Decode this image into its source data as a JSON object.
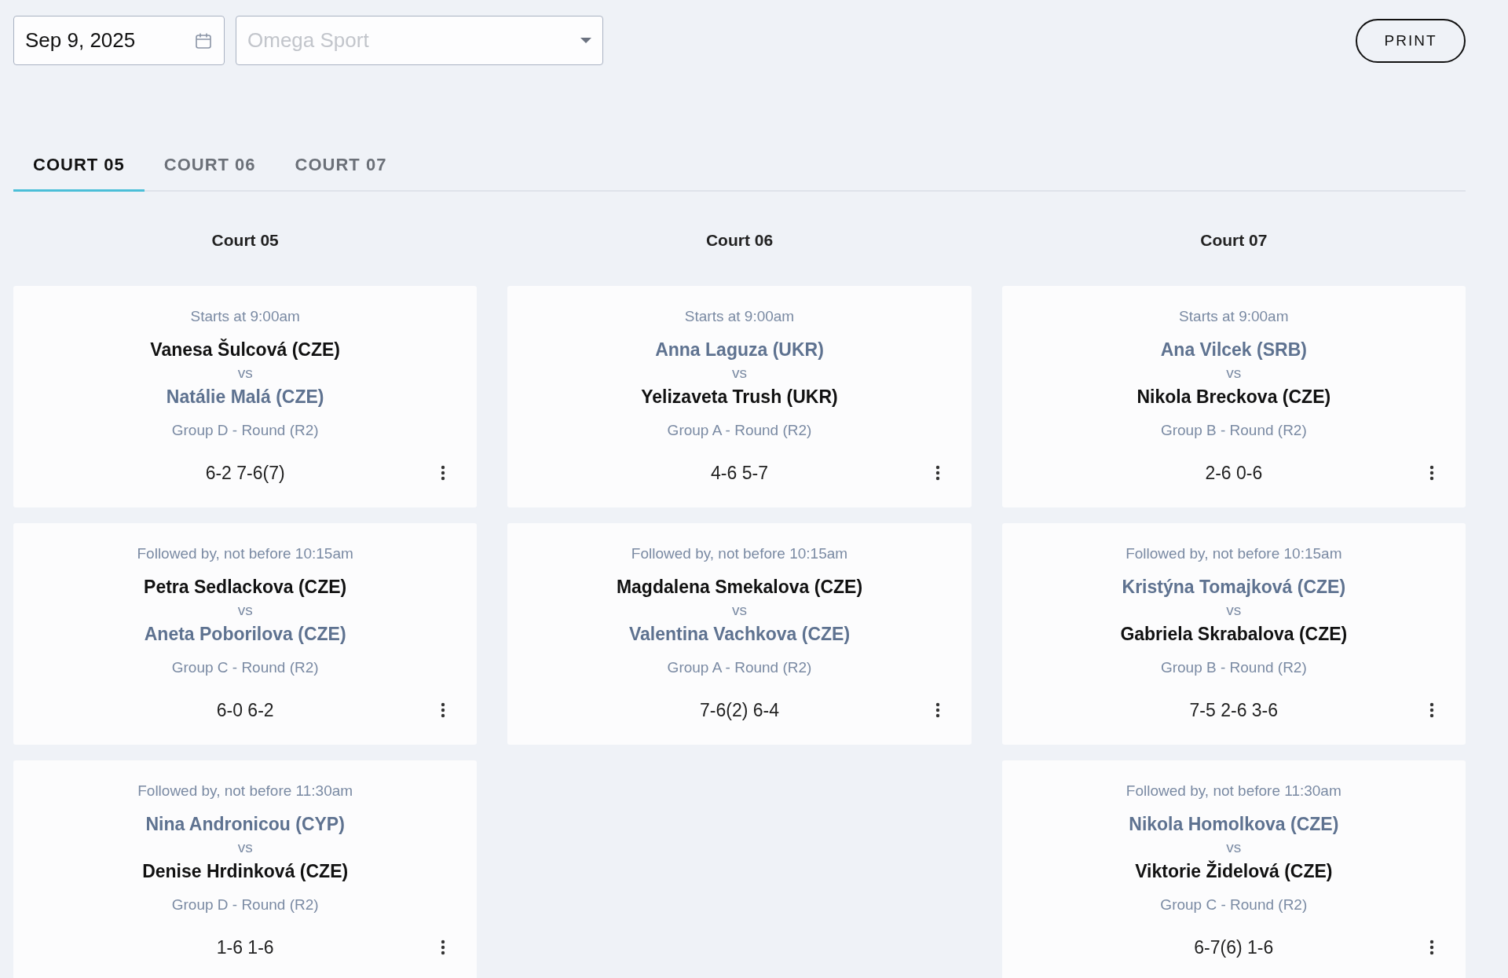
{
  "date_field": {
    "value": "Sep 9, 2025"
  },
  "venue_select": {
    "placeholder": "Omega Sport"
  },
  "print_button": "PRINT",
  "tabs": [
    {
      "label": "COURT 05",
      "selected": true
    },
    {
      "label": "COURT 06",
      "selected": false
    },
    {
      "label": "COURT 07",
      "selected": false
    }
  ],
  "courts": [
    {
      "title": "Court 05",
      "matches": [
        {
          "time": "Starts at 9:00am",
          "players": [
            {
              "name": "Vanesa Šulcová (CZE)",
              "winner": true
            },
            {
              "name": "Natálie Malá (CZE)",
              "winner": false
            }
          ],
          "vs": "vs",
          "round": "Group D - Round (R2)",
          "score": "6-2 7-6(7)"
        },
        {
          "time": "Followed by, not before 10:15am",
          "players": [
            {
              "name": "Petra Sedlackova (CZE)",
              "winner": true
            },
            {
              "name": "Aneta Poborilova (CZE)",
              "winner": false
            }
          ],
          "vs": "vs",
          "round": "Group C - Round (R2)",
          "score": "6-0 6-2"
        },
        {
          "time": "Followed by, not before 11:30am",
          "players": [
            {
              "name": "Nina Andronicou (CYP)",
              "winner": false
            },
            {
              "name": "Denise Hrdinková (CZE)",
              "winner": true
            }
          ],
          "vs": "vs",
          "round": "Group D - Round (R2)",
          "score": "1-6 1-6"
        }
      ]
    },
    {
      "title": "Court 06",
      "matches": [
        {
          "time": "Starts at 9:00am",
          "players": [
            {
              "name": "Anna Laguza (UKR)",
              "winner": false
            },
            {
              "name": "Yelizaveta Trush (UKR)",
              "winner": true
            }
          ],
          "vs": "vs",
          "round": "Group A - Round (R2)",
          "score": "4-6 5-7"
        },
        {
          "time": "Followed by, not before 10:15am",
          "players": [
            {
              "name": "Magdalena Smekalova (CZE)",
              "winner": true
            },
            {
              "name": "Valentina Vachkova (CZE)",
              "winner": false
            }
          ],
          "vs": "vs",
          "round": "Group A - Round (R2)",
          "score": "7-6(2) 6-4"
        }
      ]
    },
    {
      "title": "Court 07",
      "matches": [
        {
          "time": "Starts at 9:00am",
          "players": [
            {
              "name": "Ana Vilcek (SRB)",
              "winner": false
            },
            {
              "name": "Nikola Breckova (CZE)",
              "winner": true
            }
          ],
          "vs": "vs",
          "round": "Group B - Round (R2)",
          "score": "2-6 0-6"
        },
        {
          "time": "Followed by, not before 10:15am",
          "players": [
            {
              "name": "Kristýna Tomajková (CZE)",
              "winner": false
            },
            {
              "name": "Gabriela Skrabalova (CZE)",
              "winner": true
            }
          ],
          "vs": "vs",
          "round": "Group B - Round (R2)",
          "score": "7-5 2-6 3-6"
        },
        {
          "time": "Followed by, not before 11:30am",
          "players": [
            {
              "name": "Nikola Homolkova (CZE)",
              "winner": false
            },
            {
              "name": "Viktorie Židelová (CZE)",
              "winner": true
            }
          ],
          "vs": "vs",
          "round": "Group C - Round (R2)",
          "score": "6-7(6) 1-6"
        }
      ]
    }
  ]
}
